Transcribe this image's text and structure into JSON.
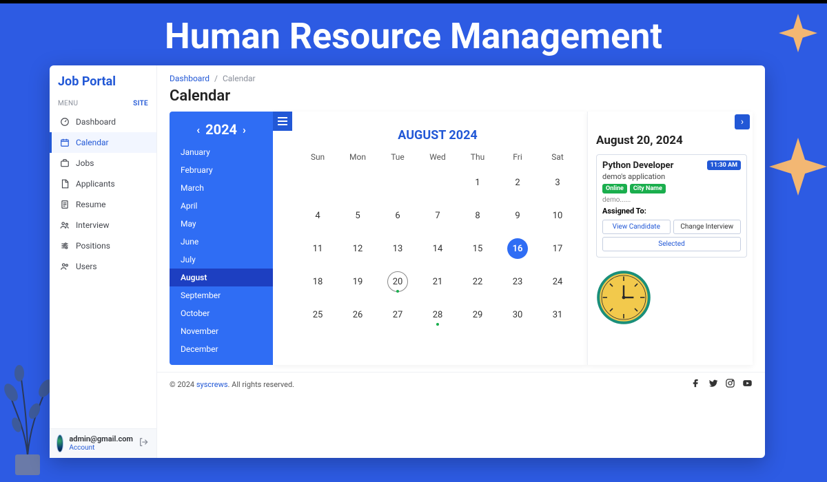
{
  "banner_title": "Human Resource Management",
  "logo": "Job Portal",
  "menu_label": "MENU",
  "site_label": "SITE",
  "nav": [
    {
      "label": "Dashboard",
      "icon": "gauge-icon"
    },
    {
      "label": "Calendar",
      "icon": "calendar-icon"
    },
    {
      "label": "Jobs",
      "icon": "briefcase-icon"
    },
    {
      "label": "Applicants",
      "icon": "document-icon"
    },
    {
      "label": "Resume",
      "icon": "file-icon"
    },
    {
      "label": "Interview",
      "icon": "people-icon"
    },
    {
      "label": "Positions",
      "icon": "sliders-icon"
    },
    {
      "label": "Users",
      "icon": "users-icon"
    }
  ],
  "nav_active_index": 1,
  "user": {
    "email": "admin@gmail.com",
    "account_label": "Account"
  },
  "breadcrumb": {
    "root": "Dashboard",
    "current": "Calendar"
  },
  "page_title": "Calendar",
  "year": "2024",
  "months": [
    "January",
    "February",
    "March",
    "April",
    "May",
    "June",
    "July",
    "August",
    "September",
    "October",
    "November",
    "December"
  ],
  "active_month_index": 7,
  "calendar": {
    "title": "AUGUST 2024",
    "dow": [
      "Sun",
      "Mon",
      "Tue",
      "Wed",
      "Thu",
      "Fri",
      "Sat"
    ],
    "leading_blanks": 4,
    "days_in_month": 31,
    "selected_day": 16,
    "today": 20,
    "event_days": [
      20,
      28
    ]
  },
  "detail": {
    "date_label": "August 20, 2024",
    "event": {
      "title": "Python Developer",
      "time": "11:30 AM",
      "subtitle": "demo's application",
      "badges": [
        "Online",
        "City Name"
      ],
      "meta": "demo......",
      "assigned_label": "Assigned To:",
      "btn_view": "View Candidate",
      "btn_change": "Change Interview",
      "btn_selected": "Selected"
    }
  },
  "footer": {
    "copyright_prefix": "© 2024 ",
    "brand": "syscrews",
    "copyright_suffix": ". All rights reserved."
  }
}
